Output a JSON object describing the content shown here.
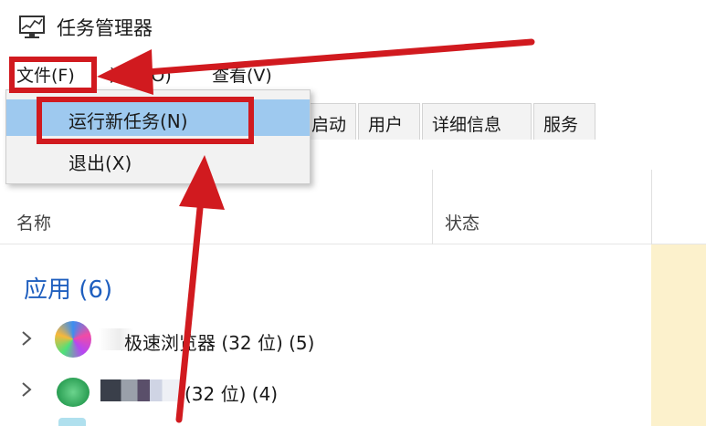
{
  "window": {
    "title": "任务管理器",
    "icon": "task-manager-icon"
  },
  "menubar": {
    "file": "文件(F)",
    "options": "选项(O)",
    "view": "查看(V)"
  },
  "file_menu": {
    "run_new_task": "运行新任务(N)",
    "exit": "退出(X)"
  },
  "tabs": {
    "startup": "启动",
    "users": "用户",
    "details": "详细信息",
    "services": "服务"
  },
  "columns": {
    "name": "名称",
    "status": "状态"
  },
  "groups": {
    "apps": "应用 (6)"
  },
  "processes": [
    {
      "name": "极速浏览器 (32 位) (5)",
      "icon": "browser-icon"
    },
    {
      "name": "(32 位) (4)",
      "icon": "app-icon"
    }
  ],
  "annotations": {
    "highlight_color": "#d11a1f",
    "highlight_targets": [
      "文件(F)",
      "运行新任务(N)"
    ]
  },
  "colors": {
    "selection": "#9ec9ef",
    "group_header": "#1f5fbf",
    "cpu_heat": "#fcf1cc"
  }
}
